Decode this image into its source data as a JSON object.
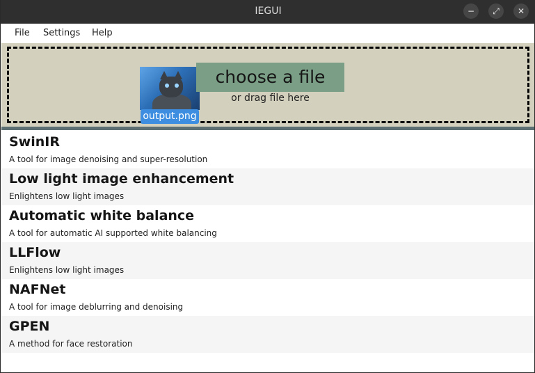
{
  "window": {
    "title": "IEGUI",
    "minimize_icon": "−",
    "maximize_icon": "⤢",
    "close_icon": "✕"
  },
  "menu": {
    "items": [
      "File",
      "Settings",
      "Help"
    ]
  },
  "dropzone": {
    "file_name": "output.png",
    "choose_label": "choose a file",
    "drag_hint": "or drag file here"
  },
  "tools": [
    {
      "name": "SwinIR",
      "description": "A tool for image denoising and super-resolution"
    },
    {
      "name": "Low light image enhancement",
      "description": "Enlightens low light images"
    },
    {
      "name": "Automatic white balance",
      "description": "A tool for automatic AI supported white balancing"
    },
    {
      "name": "LLFlow",
      "description": "Enlightens low light images"
    },
    {
      "name": "NAFNet",
      "description": "A tool for image deblurring and denoising"
    },
    {
      "name": "GPEN",
      "description": "A method for face restoration"
    }
  ],
  "colors": {
    "titlebar": "#2f2f2f",
    "dropzone_bg": "#d3d1bd",
    "choose_button": "#7b9e86",
    "file_label": "#3d8ee0",
    "separator": "#5c6f73"
  }
}
